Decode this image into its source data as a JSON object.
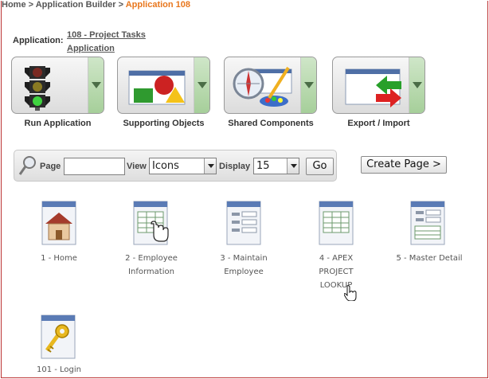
{
  "breadcrumb": {
    "home": "Home",
    "sep1": ">",
    "builder": "Application Builder",
    "sep2": ">",
    "current": "Application 108"
  },
  "application": {
    "label": "Application:",
    "name_line1": "108 - Project Tasks",
    "name_line2": "Application"
  },
  "actions": [
    {
      "label": "Run Application",
      "icon": "traffic-light-icon"
    },
    {
      "label": "Supporting Objects",
      "icon": "shapes-icon"
    },
    {
      "label": "Shared Components",
      "icon": "compass-palette-icon"
    },
    {
      "label": "Export / Import",
      "icon": "export-import-arrows-icon"
    }
  ],
  "filter": {
    "page_label": "Page",
    "page_value": "",
    "view_label": "View",
    "view_value": "Icons",
    "display_label": "Display",
    "display_value": "15",
    "go_label": "Go"
  },
  "create_page_label": "Create Page >",
  "pages": [
    {
      "line1": "1 - Home",
      "line2": "",
      "line3": "",
      "icon": "home-page-icon"
    },
    {
      "line1": "2 - Employee",
      "line2": "Information",
      "line3": "",
      "icon": "report-page-icon"
    },
    {
      "line1": "3 - Maintain",
      "line2": "Employee",
      "line3": "",
      "icon": "form-page-icon"
    },
    {
      "line1": "4 - APEX",
      "line2": "PROJECT",
      "line3": "LOOKUP",
      "icon": "report-page-icon"
    },
    {
      "line1": "5 - Master Detail",
      "line2": "",
      "line3": "",
      "icon": "form-page-icon"
    },
    {
      "line1": "101 - Login",
      "line2": "",
      "line3": "",
      "icon": "login-page-icon"
    }
  ],
  "colors": {
    "accent": "#e8761c",
    "button_arrow_zone": "#a6cf9a"
  }
}
